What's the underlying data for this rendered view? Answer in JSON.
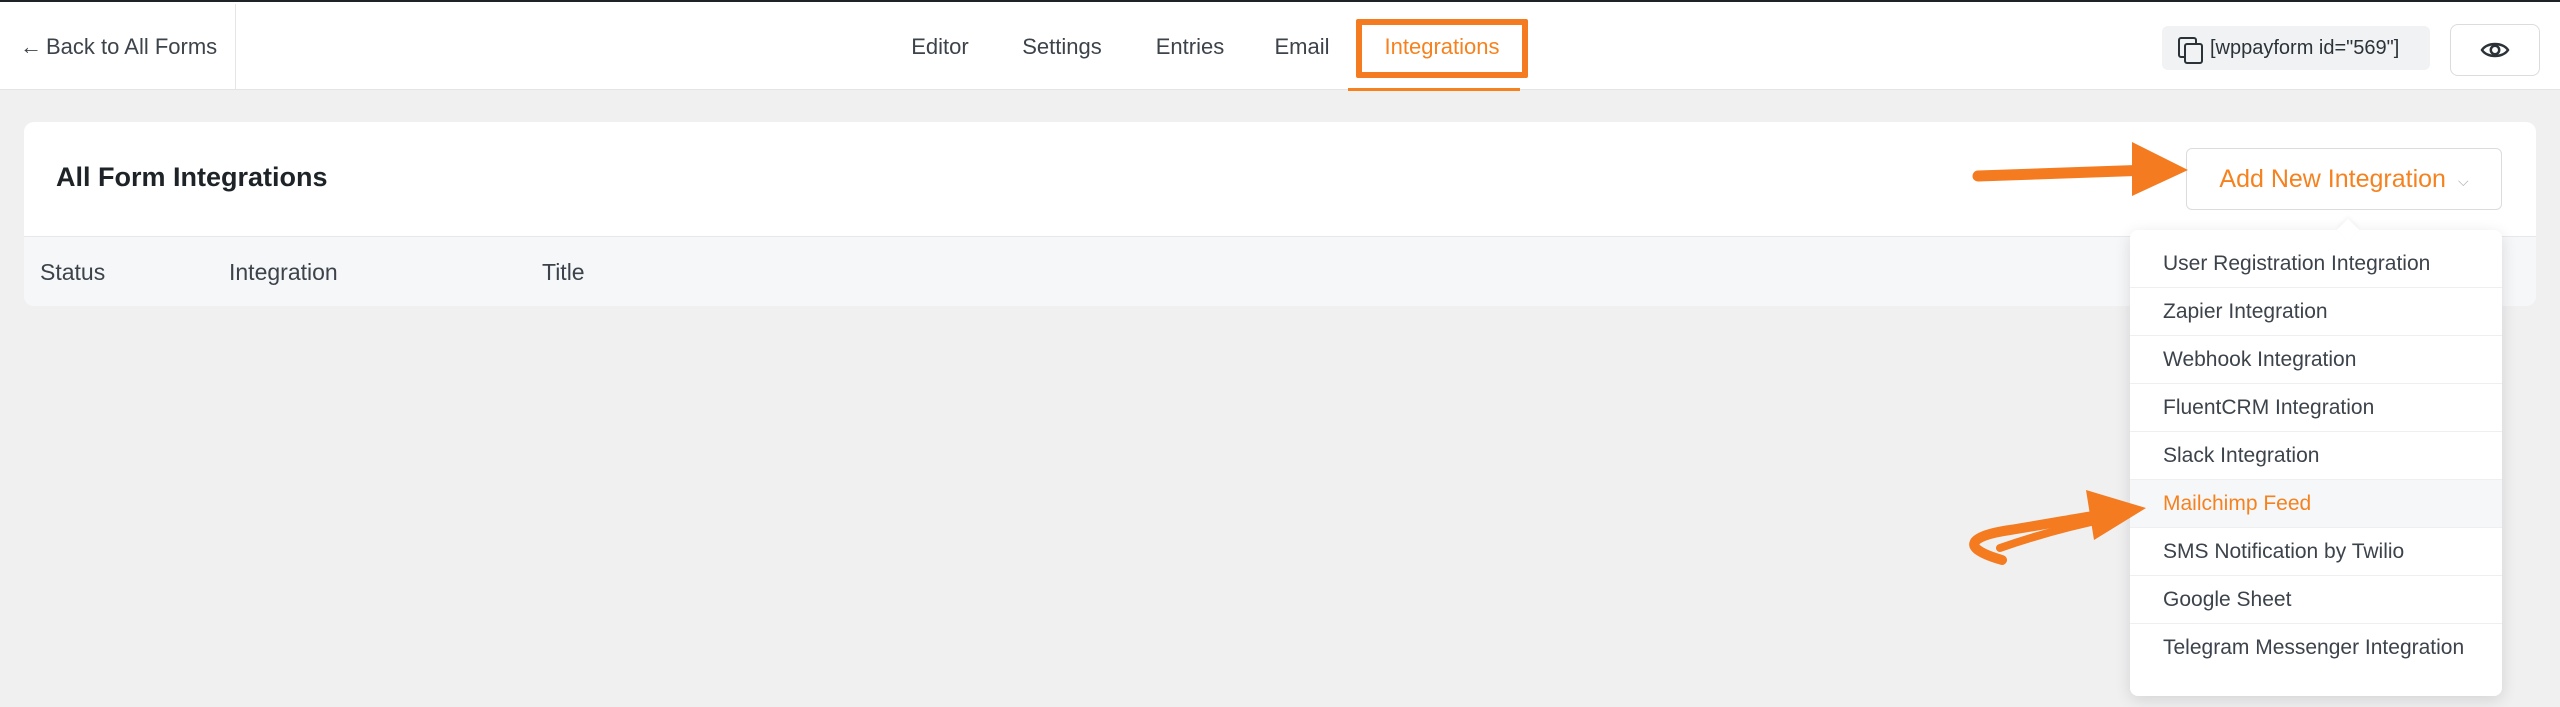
{
  "topbar": {
    "back_label": "Back to All Forms",
    "tabs": [
      {
        "label": "Editor"
      },
      {
        "label": "Settings"
      },
      {
        "label": "Entries"
      },
      {
        "label": "Email"
      },
      {
        "label": "Integrations",
        "active": true
      }
    ],
    "shortcode": "[wppayform id=\"569\"]"
  },
  "card": {
    "title": "All Form Integrations",
    "add_button": "Add New Integration",
    "columns": [
      "Status",
      "Integration",
      "Title"
    ]
  },
  "dropdown": {
    "items": [
      "User Registration Integration",
      "Zapier Integration",
      "Webhook Integration",
      "FluentCRM Integration",
      "Slack Integration",
      "Mailchimp Feed",
      "SMS Notification by Twilio",
      "Google Sheet",
      "Telegram Messenger Integration"
    ],
    "highlighted_index": 5
  },
  "colors": {
    "accent": "#f5821f",
    "annotation": "#f47b20"
  }
}
